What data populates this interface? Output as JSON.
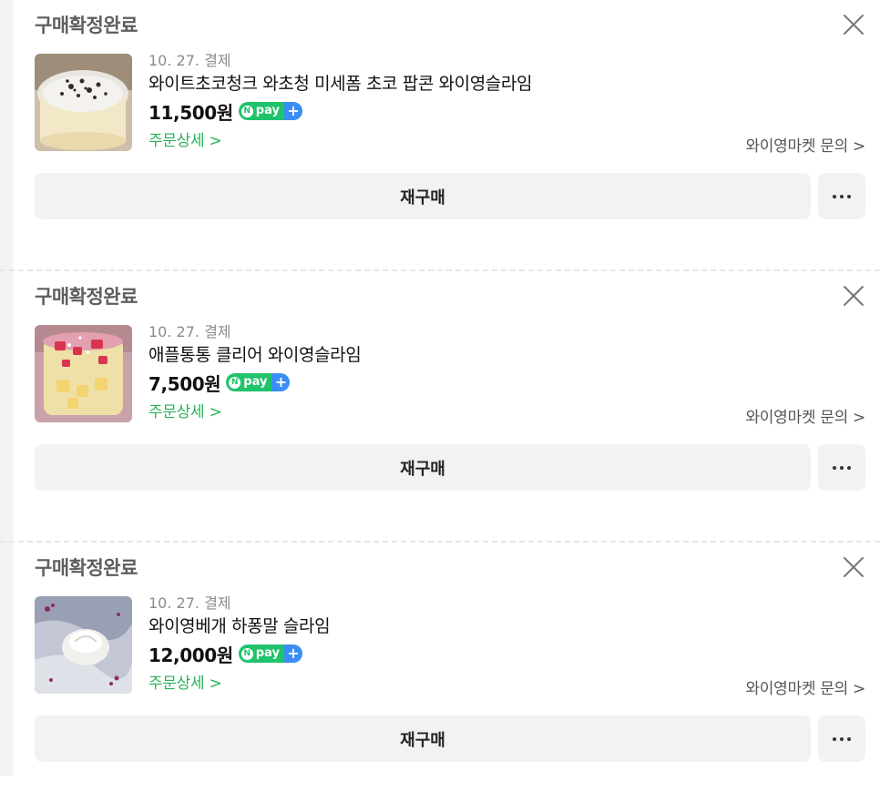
{
  "orders": [
    {
      "status": "구매확정완료",
      "pay_date": "10. 27. 결제",
      "product_name": "와이트초코청크 와초청 미세폼 초코 팝콘 와이영슬라임",
      "price": "11,500원",
      "npay_label": "pay",
      "order_detail": "주문상세 >",
      "seller_inquiry": "와이영마켓 문의 >",
      "rebuy_label": "재구매"
    },
    {
      "status": "구매확정완료",
      "pay_date": "10. 27. 결제",
      "product_name": "애플통통 클리어 와이영슬라임",
      "price": "7,500원",
      "npay_label": "pay",
      "order_detail": "주문상세 >",
      "seller_inquiry": "와이영마켓 문의 >",
      "rebuy_label": "재구매"
    },
    {
      "status": "구매확정완료",
      "pay_date": "10. 27. 결제",
      "product_name": "와이영베개 하퐁말 슬라임",
      "price": "12,000원",
      "npay_label": "pay",
      "order_detail": "주문상세 >",
      "seller_inquiry": "와이영마켓 문의 >",
      "rebuy_label": "재구매"
    }
  ],
  "colors": {
    "accent_green": "#27b35a",
    "npay_green": "#1fc36b",
    "npay_blue": "#3a8ef6",
    "button_bg": "#f1f2f4"
  },
  "icons": {
    "close": "close-icon",
    "more": "more-dots-icon",
    "npay": "npay-badge-icon"
  }
}
